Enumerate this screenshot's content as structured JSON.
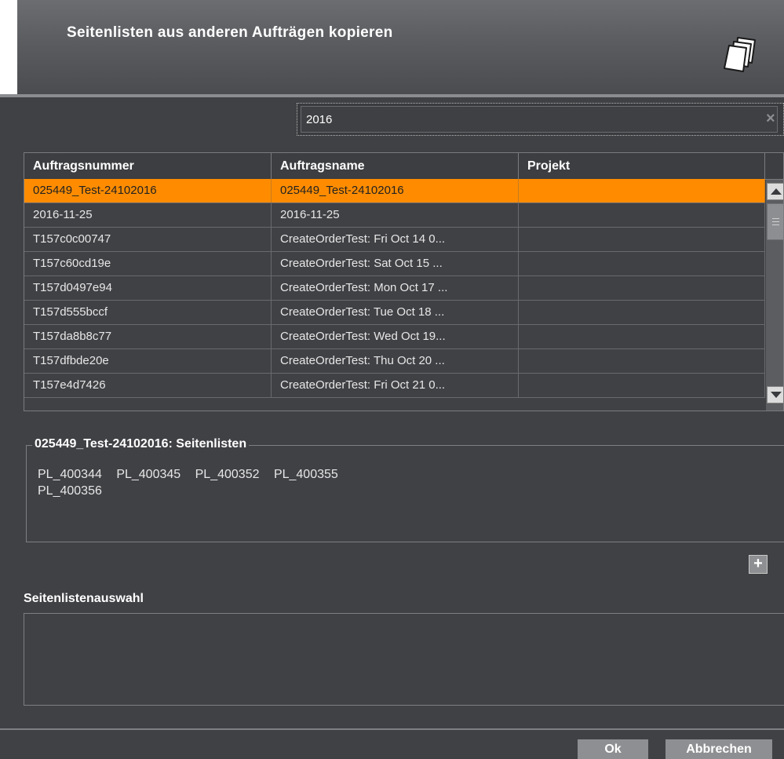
{
  "dialog": {
    "title": "Seitenlisten aus anderen Aufträgen kopieren",
    "icon": "pages-stack-icon"
  },
  "search": {
    "value": "2016",
    "clear_icon": "×"
  },
  "table": {
    "columns": [
      "Auftragsnummer",
      "Auftragsname",
      "Projekt"
    ],
    "rows": [
      {
        "number": "025449_Test-24102016",
        "name": "025449_Test-24102016",
        "project": "",
        "selected": true
      },
      {
        "number": "2016-11-25",
        "name": "2016-11-25",
        "project": ""
      },
      {
        "number": "T157c0c00747",
        "name": "CreateOrderTest: Fri Oct 14 0...",
        "project": ""
      },
      {
        "number": "T157c60cd19e",
        "name": "CreateOrderTest: Sat Oct 15 ...",
        "project": ""
      },
      {
        "number": "T157d0497e94",
        "name": "CreateOrderTest: Mon Oct 17 ...",
        "project": ""
      },
      {
        "number": "T157d555bccf",
        "name": "CreateOrderTest: Tue Oct 18 ...",
        "project": ""
      },
      {
        "number": "T157da8b8c77",
        "name": "CreateOrderTest: Wed Oct 19...",
        "project": ""
      },
      {
        "number": "T157dfbde20e",
        "name": "CreateOrderTest: Thu Oct 20 ...",
        "project": ""
      },
      {
        "number": "T157e4d7426",
        "name": "CreateOrderTest: Fri Oct 21 0...",
        "project": ""
      }
    ]
  },
  "pagelists": {
    "title": "025449_Test-24102016: Seitenlisten",
    "items": [
      "PL_400344",
      "PL_400345",
      "PL_400352",
      "PL_400355",
      "PL_400356"
    ]
  },
  "add_button": {
    "label": "+"
  },
  "selection": {
    "label": "Seitenlistenauswahl"
  },
  "buttons": {
    "ok": "Ok",
    "cancel": "Abbrechen"
  },
  "colors": {
    "selection": "#ff8c00",
    "background": "#404145"
  }
}
